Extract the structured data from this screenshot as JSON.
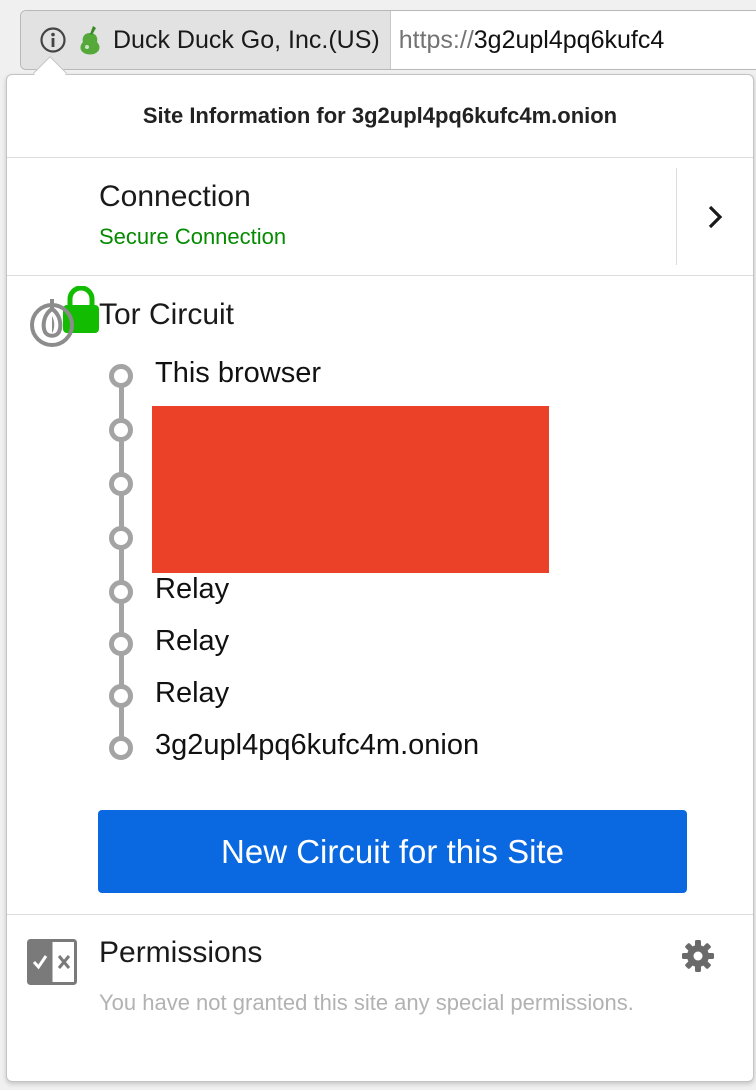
{
  "urlbar": {
    "owner": "Duck Duck Go, Inc.(US)",
    "url_scheme": "https://",
    "url_host": "3g2upl4pq6kufc4",
    "icons": [
      "info-icon",
      "pear-icon"
    ]
  },
  "panel": {
    "header": "Site Information for 3g2upl4pq6kufc4m.onion",
    "connection": {
      "title": "Connection",
      "status": "Secure Connection",
      "icon": "lock-icon",
      "status_color": "#058b00",
      "more_icon": "chevron-right-icon"
    },
    "tor": {
      "title": "Tor Circuit",
      "icon": "onion-icon",
      "nodes": [
        "This browser",
        "",
        "",
        "",
        "Relay",
        "Relay",
        "Relay",
        "3g2upl4pq6kufc4m.onion"
      ],
      "redacted_color": "#ea4128",
      "button": "New Circuit for this Site",
      "button_color": "#0a68e0"
    },
    "permissions": {
      "title": "Permissions",
      "description": "You have not granted this site any special permissions.",
      "icon": "permissions-icon",
      "settings_icon": "gear-icon"
    }
  }
}
